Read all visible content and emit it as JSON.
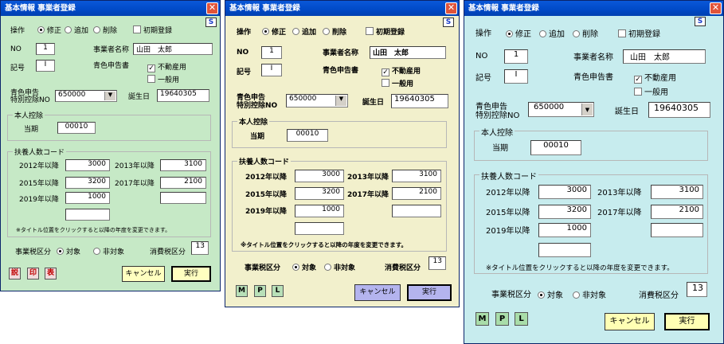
{
  "title": "基本情報 事業者登録",
  "close_glyph": "✕",
  "logo_char": "S",
  "op_label": "操作",
  "op_modify": "修正",
  "op_add": "追加",
  "op_delete": "削除",
  "initial_reg": "初期登録",
  "no_label": "NO",
  "no_value": "1",
  "kigo_label": "記号",
  "kigo_value": "I",
  "name_label": "事業者名称",
  "name_value": "山田　太郎",
  "blue_label": "青色申告書",
  "fudosan": "不動産用",
  "ippan": "一般用",
  "blue_no_label_1": "青色申告",
  "blue_no_label_2": "特別控除NO",
  "blue_no_value": "650000",
  "birth_label": "誕生日",
  "birth_value": "19640305",
  "honnin_label": "本人控除",
  "touki_label": "当期",
  "touki_value": "00010",
  "fuyou_label_a": "扶養人数コード",
  "fuyou_label_b": "扶養人数コード",
  "y2012": "2012年以降",
  "v2012": "3000",
  "y2013": "2013年以降",
  "v2013": "3100",
  "y2015": "2015年以降",
  "v2015": "3200",
  "y2017": "2017年以降",
  "v2017": "2100",
  "y2019": "2019年以降",
  "v2019": "1000",
  "note": "※タイトル位置をクリックすると以降の年度を変更できます。",
  "tax_label": "事業税区分",
  "tax_yes": "対象",
  "tax_no": "非対象",
  "cons_label": "消費税区分",
  "cons_value": "13",
  "cancel": "キャンセル",
  "exec": "実行",
  "w1_buttons": [
    "説",
    "印",
    "表"
  ],
  "w2_buttons": [
    "M",
    "P",
    "L"
  ],
  "colors": {
    "w1": "#c6e9c6",
    "w2": "#f2f0cc",
    "w3": "#c7ecee",
    "title": "#0049c6"
  }
}
